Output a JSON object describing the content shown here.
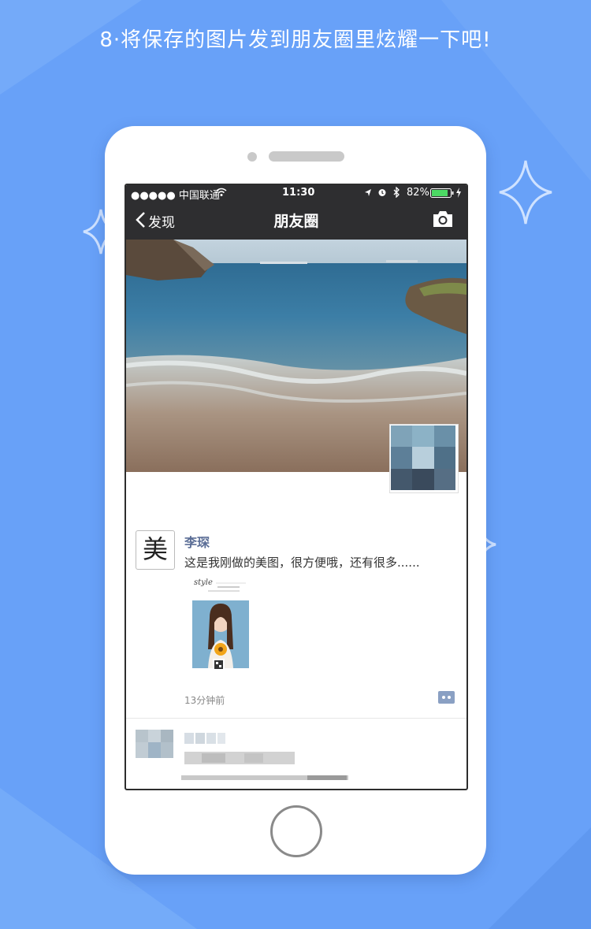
{
  "headline": "8·将保存的图片发到朋友圈里炫耀一下吧!",
  "colors": {
    "background": "#68a1f8",
    "nav_bar": "#2e2e30",
    "name_link": "#5b6e96",
    "sparkle": "#ffffff"
  },
  "status_bar": {
    "carrier": "●●●●● 中国联通",
    "time": "11:30",
    "battery": "82%",
    "icons": [
      "wifi-icon",
      "location-icon",
      "alarm-icon",
      "bluetooth-icon",
      "battery-icon",
      "charging-icon"
    ]
  },
  "nav": {
    "back_label": "发现",
    "title": "朋友圈",
    "right_icon": "camera-icon"
  },
  "post": {
    "avatar_text": "美",
    "name": "李琛",
    "text": "这是我刚做的美图，很方便哦，还有很多......",
    "time": "13分钟前",
    "image_caption": "style"
  }
}
